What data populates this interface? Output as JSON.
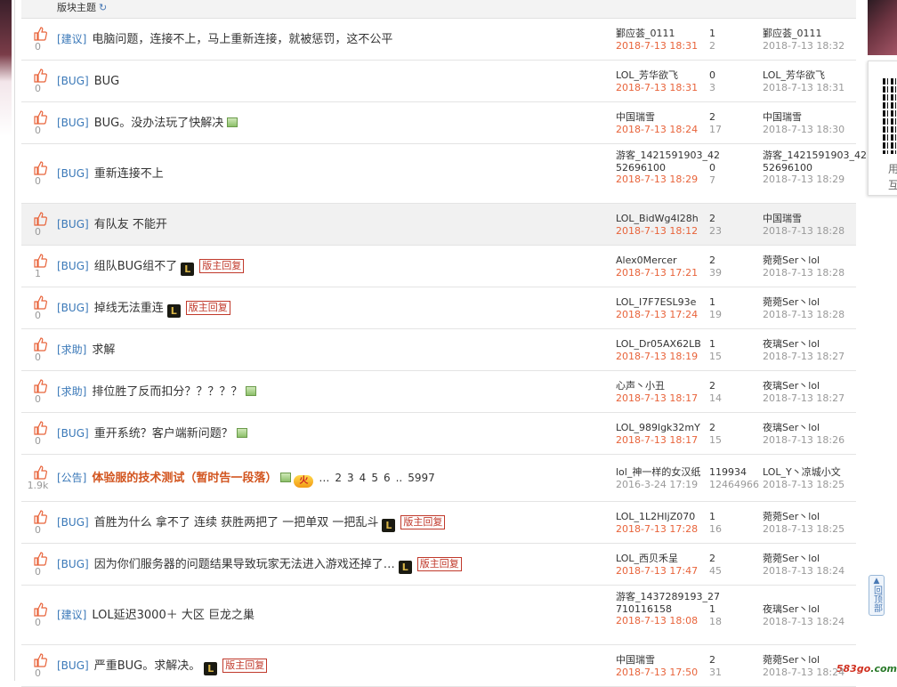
{
  "header": {
    "title": "版块主题",
    "refresh_icon": "refresh-icon"
  },
  "side": {
    "qr_text": "用",
    "qr_text2": "互",
    "backtop_label": "回顶部",
    "watermark_main": "583go",
    "watermark_tld": ".com"
  },
  "colors": {
    "tag": "#3a78b8",
    "date_orange": "#e8633a",
    "hot_title": "#d2541e",
    "mod_badge": "#c0392b"
  },
  "threads": [
    {
      "likes": "0",
      "tag": "[建议]",
      "title": "电脑问题，连接不上，马上重新连接，就被惩罚，这不公平",
      "img": false,
      "lol": false,
      "mod": false,
      "author": "鄞应荟_0111",
      "author_date": "2018-7-13 18:31",
      "replies": "1",
      "views": "2",
      "last_user": "鄞应荟_0111",
      "last_date": "2018-7-13 18:32"
    },
    {
      "likes": "0",
      "tag": "[BUG]",
      "title": "BUG",
      "img": false,
      "lol": false,
      "mod": false,
      "author": "LOL_芳华欲飞",
      "author_date": "2018-7-13 18:31",
      "replies": "0",
      "views": "3",
      "last_user": "LOL_芳华欲飞",
      "last_date": "2018-7-13 18:31"
    },
    {
      "likes": "0",
      "tag": "[BUG]",
      "title": "BUG。没办法玩了快解决",
      "img": true,
      "lol": false,
      "mod": false,
      "author": "中国瑞雪",
      "author_date": "2018-7-13 18:24",
      "replies": "2",
      "views": "17",
      "last_user": "中国瑞雪",
      "last_date": "2018-7-13 18:30"
    },
    {
      "likes": "0",
      "tag": "[BUG]",
      "title": "重新连接不上",
      "img": false,
      "lol": false,
      "mod": false,
      "author": "游客_1421591903_4252696100",
      "author_date": "2018-7-13 18:29",
      "replies": "0",
      "views": "7",
      "last_user": "游客_1421591903_4252696100",
      "last_date": "2018-7-13 18:29"
    },
    {
      "likes": "0",
      "tag": "[BUG]",
      "title": "有队友 不能开",
      "img": false,
      "lol": false,
      "mod": false,
      "author": "LOL_BidWg4I28h",
      "author_date": "2018-7-13 18:12",
      "replies": "2",
      "views": "23",
      "last_user": "中国瑞雪",
      "last_date": "2018-7-13 18:28"
    },
    {
      "likes": "1",
      "tag": "[BUG]",
      "title": "组队BUG组不了",
      "img": false,
      "lol": true,
      "mod": true,
      "author": "Alex0Mercer",
      "author_date": "2018-7-13 17:21",
      "replies": "2",
      "views": "39",
      "last_user": "菀菀Ser丶lol",
      "last_date": "2018-7-13 18:28"
    },
    {
      "likes": "0",
      "tag": "[BUG]",
      "title": "掉线无法重连",
      "img": false,
      "lol": true,
      "mod": true,
      "author": "LOL_I7F7ESL93e",
      "author_date": "2018-7-13 17:24",
      "replies": "1",
      "views": "19",
      "last_user": "菀菀Ser丶lol",
      "last_date": "2018-7-13 18:28"
    },
    {
      "likes": "0",
      "tag": "[求助]",
      "title": "求解",
      "img": false,
      "lol": false,
      "mod": false,
      "author": "LOL_Dr05AX62LB",
      "author_date": "2018-7-13 18:19",
      "replies": "1",
      "views": "15",
      "last_user": "夜璃Ser丶lol",
      "last_date": "2018-7-13 18:27"
    },
    {
      "likes": "0",
      "tag": "[求助]",
      "title": "排位胜了反而扣分？？？？？",
      "img": true,
      "lol": false,
      "mod": false,
      "author": "心声丶小丑",
      "author_date": "2018-7-13 18:17",
      "replies": "2",
      "views": "14",
      "last_user": "夜璃Ser丶lol",
      "last_date": "2018-7-13 18:27"
    },
    {
      "likes": "0",
      "tag": "[BUG]",
      "title": "重开系统？客户端新问题？",
      "img": true,
      "lol": false,
      "mod": false,
      "author": "LOL_989lgk32mY",
      "author_date": "2018-7-13 18:17",
      "replies": "2",
      "views": "15",
      "last_user": "夜璃Ser丶lol",
      "last_date": "2018-7-13 18:26"
    },
    {
      "likes": "1.9k",
      "tag": "[公告]",
      "title": "体验服的技术测试（暂时告一段落）",
      "hot": true,
      "img": true,
      "lol": false,
      "mod": false,
      "pages": [
        "…",
        "2",
        "3",
        "4",
        "5",
        "6",
        "..",
        "5997"
      ],
      "author": "lol_神一样的女汉纸",
      "author_date": "2016-3-24 17:19",
      "replies": "119934",
      "views": "12464966",
      "last_user": "LOL_Y丶凉城小文",
      "last_date": "2018-7-13 18:25"
    },
    {
      "likes": "0",
      "tag": "[BUG]",
      "title": "首胜为什么 拿不了 连续 获胜两把了 一把单双 一把乱斗",
      "img": false,
      "lol": true,
      "mod": true,
      "author": "LOL_1L2HIjZ070",
      "author_date": "2018-7-13 17:28",
      "replies": "1",
      "views": "16",
      "last_user": "菀菀Ser丶lol",
      "last_date": "2018-7-13 18:25"
    },
    {
      "likes": "0",
      "tag": "[BUG]",
      "title": "因为你们服务器的问题结果导致玩家无法进入游戏还掉了…",
      "img": false,
      "lol": true,
      "mod": true,
      "author": "LOL_西贝禾呈",
      "author_date": "2018-7-13 17:47",
      "replies": "2",
      "views": "45",
      "last_user": "菀菀Ser丶lol",
      "last_date": "2018-7-13 18:24"
    },
    {
      "likes": "0",
      "tag": "[建议]",
      "title": "LOL延迟3000＋ 大区 巨龙之巢",
      "img": false,
      "lol": false,
      "mod": false,
      "author": "游客_1437289193_27710116158",
      "author_date": "2018-7-13 18:08",
      "replies": "1",
      "views": "18",
      "last_user": "夜璃Ser丶lol",
      "last_date": "2018-7-13 18:24"
    },
    {
      "likes": "0",
      "tag": "[BUG]",
      "title": "严重BUG。求解决。",
      "img": false,
      "lol": true,
      "mod": true,
      "author": "中国瑞雪",
      "author_date": "2018-7-13 17:50",
      "replies": "2",
      "views": "31",
      "last_user": "菀菀Ser丶lol",
      "last_date": "2018-7-13 18:24"
    }
  ],
  "labels": {
    "mod_reply": "版主回复",
    "lol_glyph": "L",
    "hot_glyph": "火"
  }
}
